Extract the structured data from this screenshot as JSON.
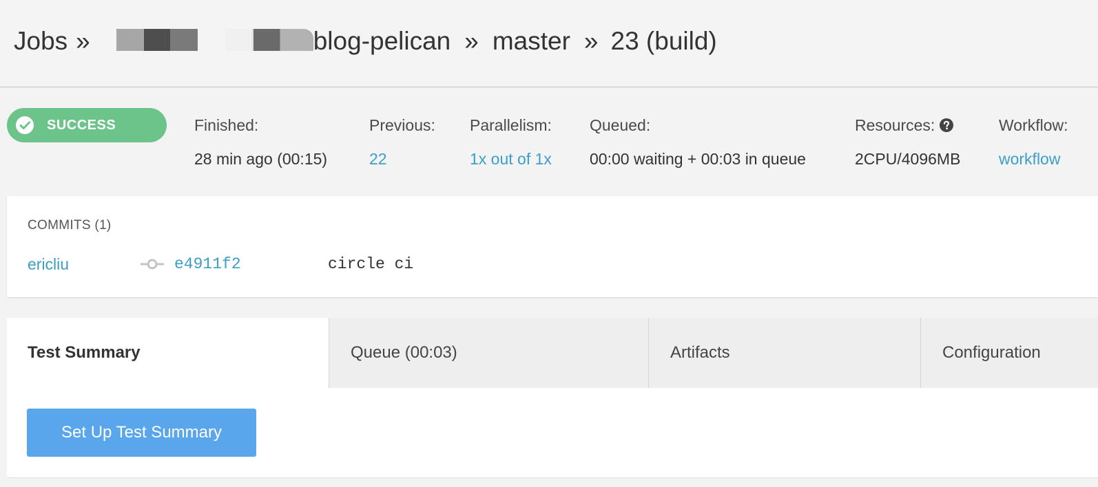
{
  "breadcrumb": {
    "jobs": "Jobs",
    "separator": "»",
    "project": "blog-pelican",
    "branch": "master",
    "build": "23 (build)"
  },
  "status": {
    "label": "SUCCESS",
    "color": "#6cc48a",
    "icon": "check-circle-icon"
  },
  "meta": {
    "finished": {
      "label": "Finished:",
      "value": "28 min ago (00:15)"
    },
    "previous": {
      "label": "Previous:",
      "value": "22"
    },
    "parallelism": {
      "label": "Parallelism:",
      "value": "1x out of 1x"
    },
    "queued": {
      "label": "Queued:",
      "value": "00:00 waiting + 00:03 in queue"
    },
    "resources": {
      "label": "Resources:",
      "value": "2CPU/4096MB",
      "icon": "question-circle-icon"
    },
    "workflow": {
      "label": "Workflow:",
      "value": "workflow"
    }
  },
  "commits": {
    "title": "COMMITS (1)",
    "items": [
      {
        "author": "ericliu",
        "hash": "e4911f2",
        "message": "circle ci",
        "icon": "git-commit-icon"
      }
    ]
  },
  "tabs": [
    {
      "label": "Test Summary",
      "active": true
    },
    {
      "label": "Queue (00:03)",
      "active": false
    },
    {
      "label": "Artifacts",
      "active": false
    },
    {
      "label": "Configuration",
      "active": false
    }
  ],
  "content": {
    "button_label": "Set Up Test Summary"
  },
  "colors": {
    "link": "#3b9ec7",
    "primary_button": "#5aa6ec"
  }
}
